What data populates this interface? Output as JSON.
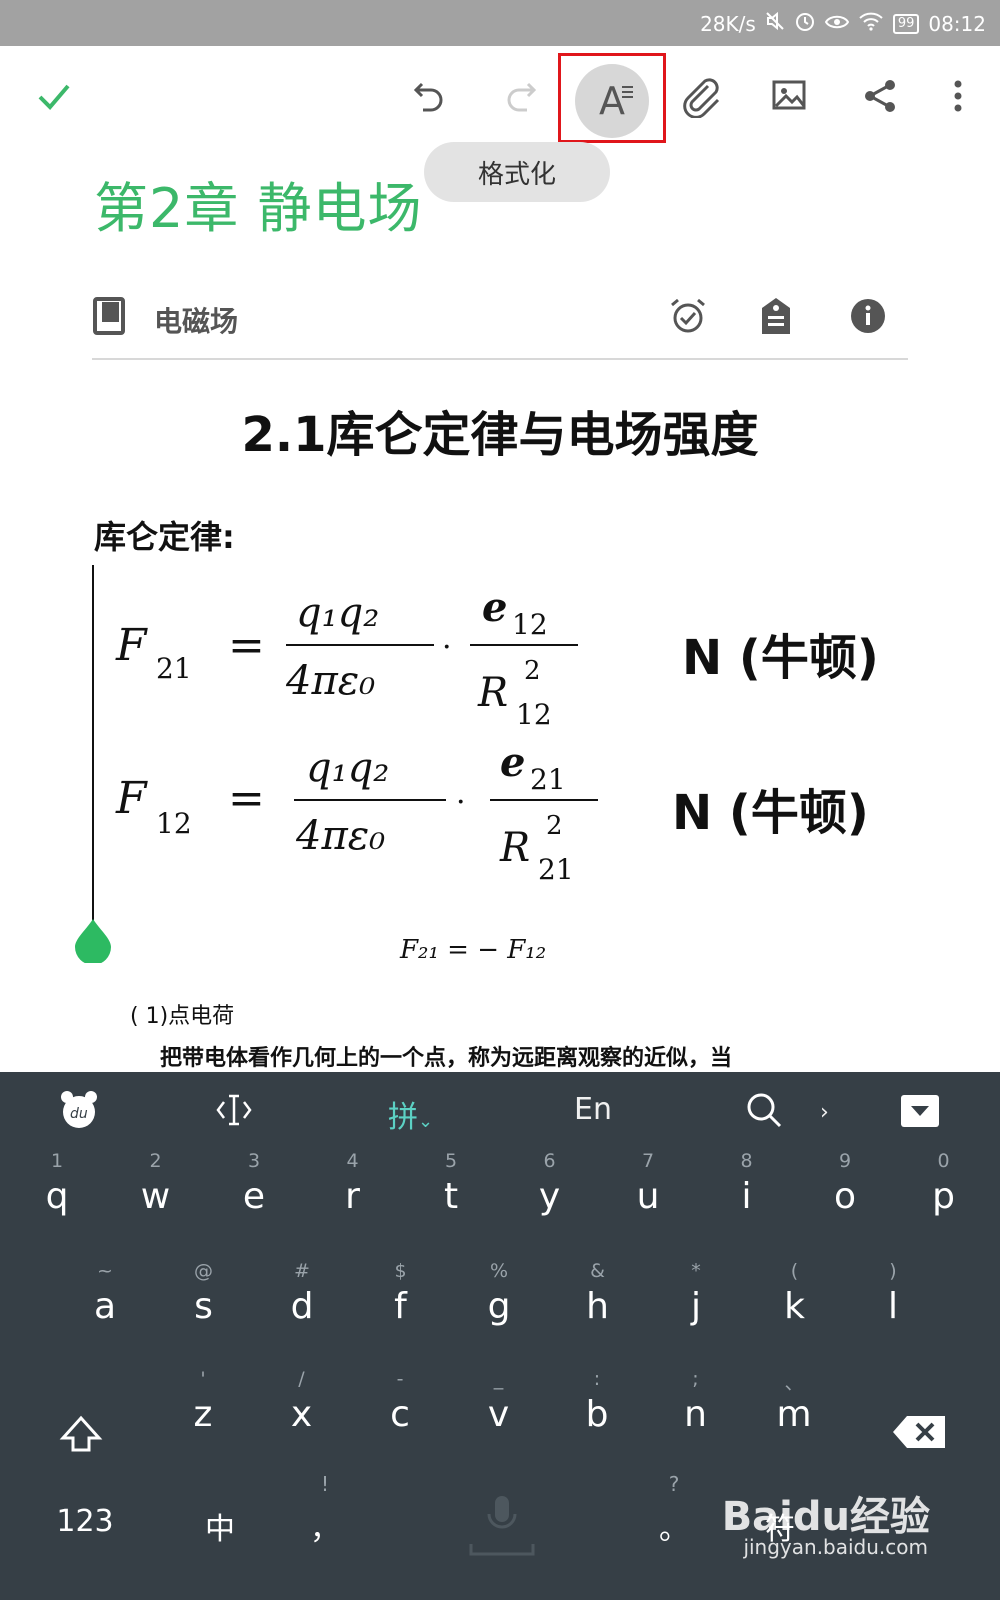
{
  "status_bar": {
    "net_speed": "28K/s",
    "battery": "99",
    "time": "08:12"
  },
  "toolbar": {
    "format_tooltip": "格式化"
  },
  "note": {
    "title": "第2章 静电场",
    "notebook": "电磁场"
  },
  "content": {
    "heading": "2.1库仑定律与电场强度",
    "subheading": "库仑定律:",
    "formula1": {
      "lhs": "F",
      "lhs_sub": "21",
      "num": "q₁q₂",
      "den": "4πε₀",
      "vec_num": "e",
      "vec_num_sub": "12",
      "vec_den": "R",
      "vec_den_sup": "2",
      "vec_den_sub": "12",
      "unit": "N (牛顿)"
    },
    "formula2": {
      "lhs": "F",
      "lhs_sub": "12",
      "num": "q₁q₂",
      "den": "4πε₀",
      "vec_num": "e",
      "vec_num_sub": "21",
      "vec_den": "R",
      "vec_den_sup": "2",
      "vec_den_sub": "21",
      "unit": "N (牛顿)"
    },
    "relation": "F₂₁ = − F₁₂",
    "point_charge": "( 1)点电荷",
    "paragraph": "把带电体看作几何上的一个点，称为远距离观察的近似，当"
  },
  "keyboard": {
    "toolbar": {
      "pinyin": "拼",
      "english": "En"
    },
    "row1": [
      {
        "hint": "1",
        "key": "q"
      },
      {
        "hint": "2",
        "key": "w"
      },
      {
        "hint": "3",
        "key": "e"
      },
      {
        "hint": "4",
        "key": "r"
      },
      {
        "hint": "5",
        "key": "t"
      },
      {
        "hint": "6",
        "key": "y"
      },
      {
        "hint": "7",
        "key": "u"
      },
      {
        "hint": "8",
        "key": "i"
      },
      {
        "hint": "9",
        "key": "o"
      },
      {
        "hint": "0",
        "key": "p"
      }
    ],
    "row2": [
      {
        "hint": "~",
        "key": "a"
      },
      {
        "hint": "@",
        "key": "s"
      },
      {
        "hint": "#",
        "key": "d"
      },
      {
        "hint": "$",
        "key": "f"
      },
      {
        "hint": "%",
        "key": "g"
      },
      {
        "hint": "&",
        "key": "h"
      },
      {
        "hint": "*",
        "key": "j"
      },
      {
        "hint": "(",
        "key": "k"
      },
      {
        "hint": ")",
        "key": "l"
      }
    ],
    "row3": [
      {
        "hint": "'",
        "key": "z"
      },
      {
        "hint": "/",
        "key": "x"
      },
      {
        "hint": "-",
        "key": "c"
      },
      {
        "hint": "_",
        "key": "v"
      },
      {
        "hint": ":",
        "key": "b"
      },
      {
        "hint": ";",
        "key": "n"
      },
      {
        "hint": "、",
        "key": "m"
      }
    ],
    "bottom": {
      "numbers": "123",
      "chinese": "中",
      "comma_hint": "!",
      "comma": "，",
      "period_hint": "?",
      "period": "。",
      "symbols": "符"
    },
    "watermark": "Baidu经验",
    "watermark_url": "jingyan.baidu.com"
  }
}
